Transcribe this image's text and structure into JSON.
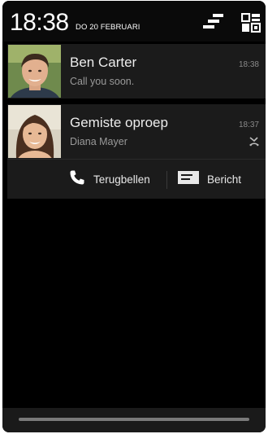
{
  "status": {
    "time": "18:38",
    "date": "DO 20 FEBRUARI"
  },
  "icons": {
    "clear_all": "clear-all-icon",
    "quick_settings": "quick-settings-icon",
    "missed_call": "missed-call-icon",
    "phone": "phone-icon",
    "message": "message-icon"
  },
  "notifications": [
    {
      "title": "Ben Carter",
      "subtitle": "Call you soon.",
      "time": "18:38"
    },
    {
      "title": "Gemiste oproep",
      "subtitle": "Diana Mayer",
      "time": "18:37",
      "actions": [
        {
          "label": "Terugbellen"
        },
        {
          "label": "Bericht"
        }
      ]
    }
  ],
  "colors": {
    "background": "#000000",
    "card": "#1b1b1b",
    "primary_text": "#ececec",
    "secondary_text": "#9a9a9a"
  }
}
